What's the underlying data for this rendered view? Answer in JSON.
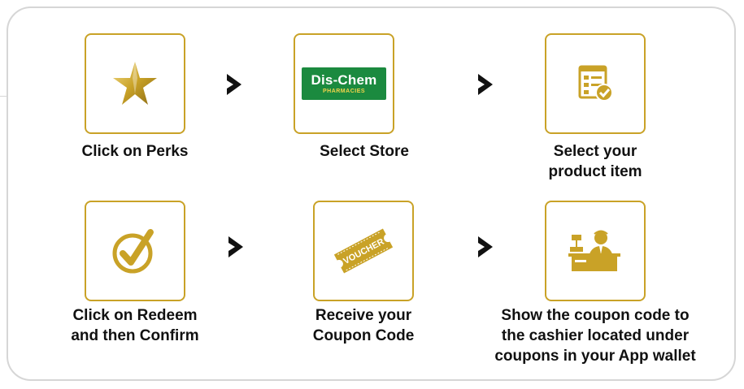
{
  "colors": {
    "gold": "#c9a227",
    "frame": "#d6d6d6",
    "dischem_green": "#1b8a3f",
    "text": "#111111"
  },
  "store_logo": {
    "name": "Dis-Chem",
    "sub": "PHARMACIES"
  },
  "voucher_label": "VOUCHER",
  "steps": [
    {
      "icon": "star-icon",
      "caption": [
        "Click on Perks"
      ]
    },
    {
      "icon": "dischem-logo",
      "caption": [
        "Select Store"
      ]
    },
    {
      "icon": "product-list-check-icon",
      "caption": [
        "Select your",
        "product item"
      ]
    },
    {
      "icon": "checkmark-circle-icon",
      "caption": [
        "Click on Redeem",
        "and then Confirm"
      ]
    },
    {
      "icon": "voucher-icon",
      "caption": [
        "Receive your",
        "Coupon Code"
      ]
    },
    {
      "icon": "cashier-icon",
      "caption": [
        "Show the coupon code to",
        "the cashier located under",
        "coupons in your App wallet"
      ]
    }
  ]
}
